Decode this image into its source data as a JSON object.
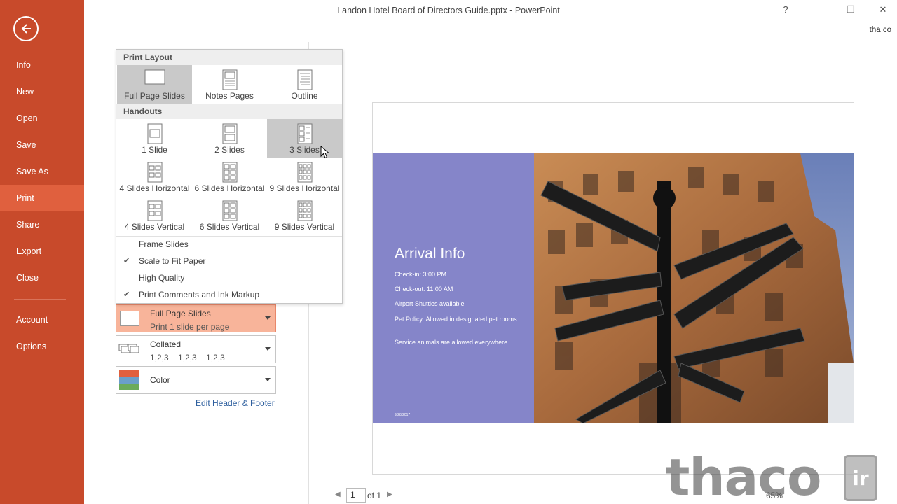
{
  "window": {
    "title": "Landon Hotel Board of Directors Guide.pptx - PowerPoint",
    "help": "?",
    "minimize": "—",
    "restore": "❐",
    "close": "✕",
    "account": "tha co"
  },
  "sidebar": {
    "back_icon": "back-arrow-icon",
    "items": [
      {
        "label": "Info"
      },
      {
        "label": "New"
      },
      {
        "label": "Open"
      },
      {
        "label": "Save"
      },
      {
        "label": "Save As"
      },
      {
        "label": "Print",
        "active": true
      },
      {
        "label": "Share"
      },
      {
        "label": "Export"
      },
      {
        "label": "Close"
      },
      {
        "label": "Account"
      },
      {
        "label": "Options"
      }
    ]
  },
  "print_layout_menu": {
    "header_layout": "Print Layout",
    "layouts": [
      {
        "label": "Full Page Slides",
        "selected": true
      },
      {
        "label": "Notes Pages"
      },
      {
        "label": "Outline"
      }
    ],
    "header_handouts": "Handouts",
    "handouts": [
      {
        "label": "1 Slide"
      },
      {
        "label": "2 Slides"
      },
      {
        "label": "3 Slides",
        "hover": true
      },
      {
        "label": "4 Slides Horizontal"
      },
      {
        "label": "6 Slides Horizontal"
      },
      {
        "label": "9 Slides Horizontal"
      },
      {
        "label": "4 Slides Vertical"
      },
      {
        "label": "6 Slides Vertical"
      },
      {
        "label": "9 Slides Vertical"
      }
    ],
    "options": [
      {
        "label": "Frame Slides",
        "checked": false
      },
      {
        "label": "Scale to Fit Paper",
        "checked": true
      },
      {
        "label": "High Quality",
        "checked": false
      },
      {
        "label": "Print Comments and Ink Markup",
        "checked": true
      }
    ]
  },
  "settings": {
    "layout": {
      "title": "Full Page Slides",
      "subtitle": "Print 1 slide per page"
    },
    "collation": {
      "title": "Collated",
      "subtitle": "1,2,3    1,2,3    1,2,3"
    },
    "color": {
      "title": "Color"
    },
    "edit_header_footer": "Edit Header & Footer"
  },
  "preview": {
    "slide_title": "Arrival Info",
    "lines": [
      "Check-in: 3:00 PM",
      "Check-out: 11:00 AM",
      "Airport Shuttles available",
      "Pet Policy: Allowed in designated pet rooms",
      "Service animals are allowed everywhere."
    ],
    "date": "9/28/2017",
    "panel_color": "#8585c9"
  },
  "pager": {
    "current": "1",
    "of_label": "of 1"
  },
  "zoom": "65%",
  "watermark": {
    "text": "thaco",
    "box_text": "ir"
  },
  "colors": {
    "sidebar": "#c84a2b",
    "active": "#e0603e",
    "highlight": "#f8b49a"
  }
}
